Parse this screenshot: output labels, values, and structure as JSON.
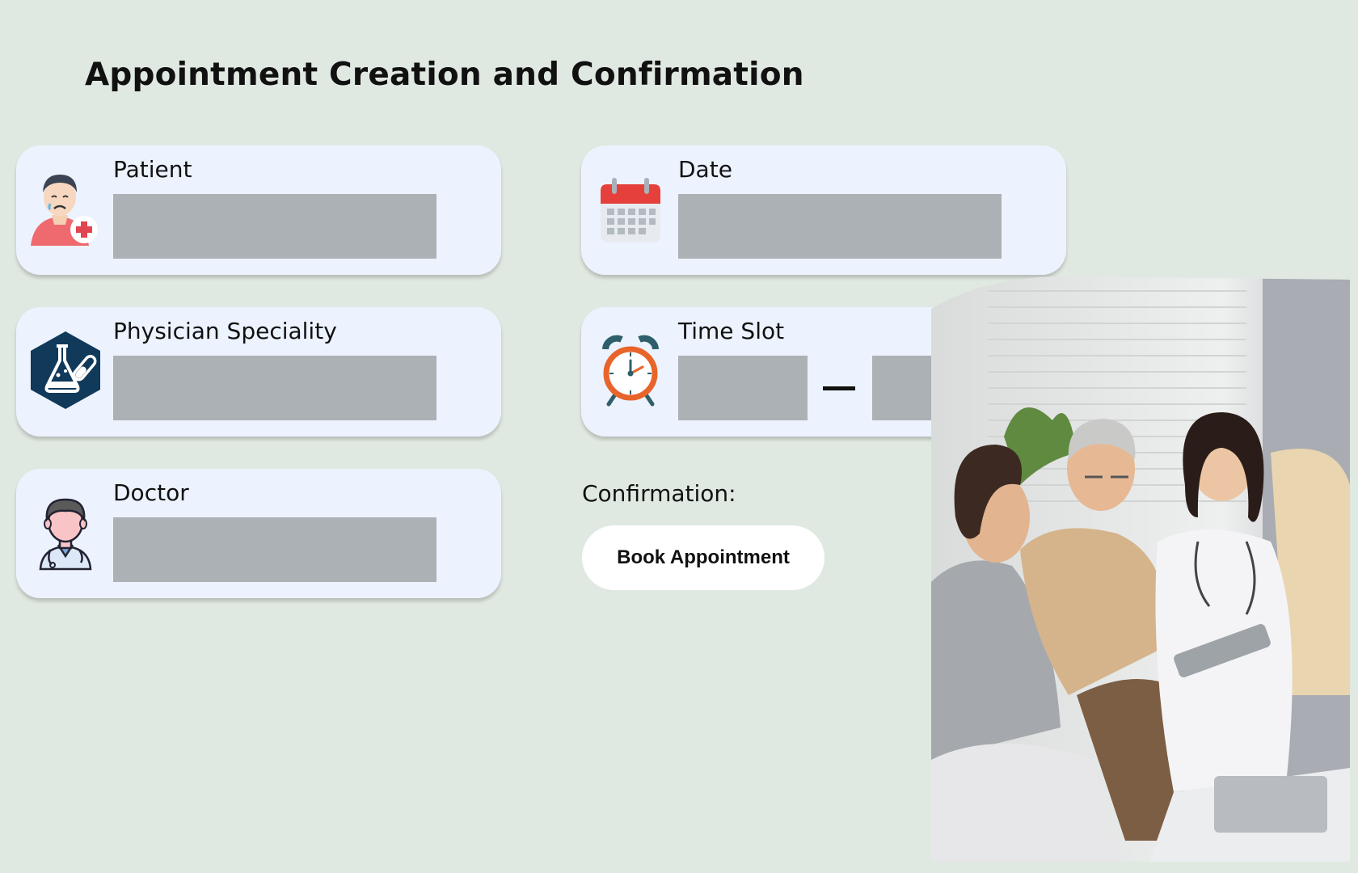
{
  "page": {
    "title": "Appointment Creation and Confirmation"
  },
  "form": {
    "patient": {
      "label": "Patient",
      "value": "",
      "icon": "sick-patient-icon"
    },
    "specialty": {
      "label": "Physician Speciality",
      "value": "",
      "icon": "lab-flask-icon"
    },
    "doctor": {
      "label": "Doctor",
      "value": "",
      "icon": "doctor-avatar-icon"
    },
    "date": {
      "label": "Date",
      "value": "",
      "icon": "calendar-icon"
    },
    "time_slot": {
      "label": "Time Slot",
      "start": "",
      "end": "",
      "icon": "alarm-clock-icon"
    }
  },
  "confirmation": {
    "label": "Confirmation:",
    "button_label": "Book Appointment"
  },
  "photo": {
    "subject": "doctor-consultation-photo"
  },
  "colors": {
    "background": "#e0e9e1",
    "card": "#ecf3fe",
    "field": "#acb1b5",
    "button": "#ffffff"
  }
}
